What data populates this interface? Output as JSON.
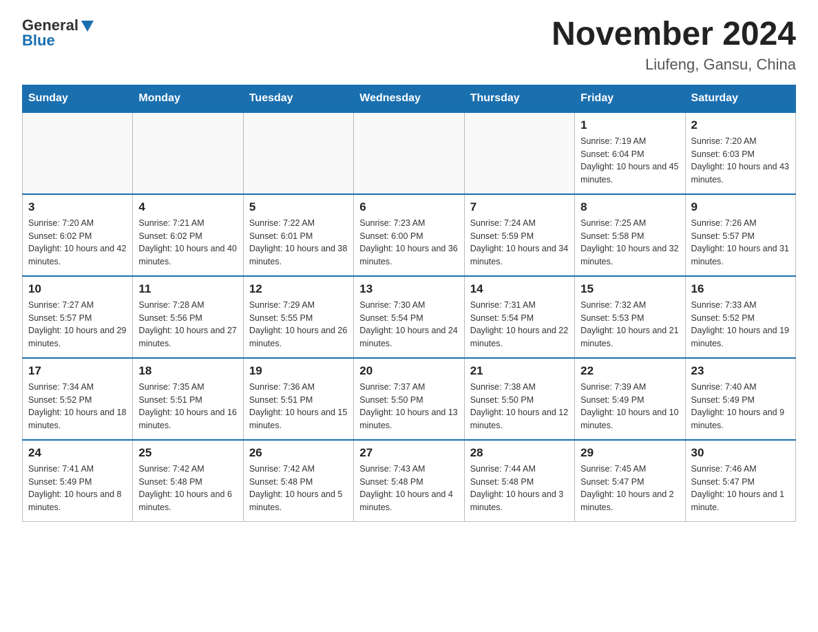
{
  "header": {
    "logo_general": "General",
    "logo_blue": "Blue",
    "month_title": "November 2024",
    "location": "Liufeng, Gansu, China"
  },
  "weekdays": [
    "Sunday",
    "Monday",
    "Tuesday",
    "Wednesday",
    "Thursday",
    "Friday",
    "Saturday"
  ],
  "weeks": [
    [
      {
        "day": "",
        "sunrise": "",
        "sunset": "",
        "daylight": "",
        "empty": true
      },
      {
        "day": "",
        "sunrise": "",
        "sunset": "",
        "daylight": "",
        "empty": true
      },
      {
        "day": "",
        "sunrise": "",
        "sunset": "",
        "daylight": "",
        "empty": true
      },
      {
        "day": "",
        "sunrise": "",
        "sunset": "",
        "daylight": "",
        "empty": true
      },
      {
        "day": "",
        "sunrise": "",
        "sunset": "",
        "daylight": "",
        "empty": true
      },
      {
        "day": "1",
        "sunrise": "Sunrise: 7:19 AM",
        "sunset": "Sunset: 6:04 PM",
        "daylight": "Daylight: 10 hours and 45 minutes.",
        "empty": false
      },
      {
        "day": "2",
        "sunrise": "Sunrise: 7:20 AM",
        "sunset": "Sunset: 6:03 PM",
        "daylight": "Daylight: 10 hours and 43 minutes.",
        "empty": false
      }
    ],
    [
      {
        "day": "3",
        "sunrise": "Sunrise: 7:20 AM",
        "sunset": "Sunset: 6:02 PM",
        "daylight": "Daylight: 10 hours and 42 minutes.",
        "empty": false
      },
      {
        "day": "4",
        "sunrise": "Sunrise: 7:21 AM",
        "sunset": "Sunset: 6:02 PM",
        "daylight": "Daylight: 10 hours and 40 minutes.",
        "empty": false
      },
      {
        "day": "5",
        "sunrise": "Sunrise: 7:22 AM",
        "sunset": "Sunset: 6:01 PM",
        "daylight": "Daylight: 10 hours and 38 minutes.",
        "empty": false
      },
      {
        "day": "6",
        "sunrise": "Sunrise: 7:23 AM",
        "sunset": "Sunset: 6:00 PM",
        "daylight": "Daylight: 10 hours and 36 minutes.",
        "empty": false
      },
      {
        "day": "7",
        "sunrise": "Sunrise: 7:24 AM",
        "sunset": "Sunset: 5:59 PM",
        "daylight": "Daylight: 10 hours and 34 minutes.",
        "empty": false
      },
      {
        "day": "8",
        "sunrise": "Sunrise: 7:25 AM",
        "sunset": "Sunset: 5:58 PM",
        "daylight": "Daylight: 10 hours and 32 minutes.",
        "empty": false
      },
      {
        "day": "9",
        "sunrise": "Sunrise: 7:26 AM",
        "sunset": "Sunset: 5:57 PM",
        "daylight": "Daylight: 10 hours and 31 minutes.",
        "empty": false
      }
    ],
    [
      {
        "day": "10",
        "sunrise": "Sunrise: 7:27 AM",
        "sunset": "Sunset: 5:57 PM",
        "daylight": "Daylight: 10 hours and 29 minutes.",
        "empty": false
      },
      {
        "day": "11",
        "sunrise": "Sunrise: 7:28 AM",
        "sunset": "Sunset: 5:56 PM",
        "daylight": "Daylight: 10 hours and 27 minutes.",
        "empty": false
      },
      {
        "day": "12",
        "sunrise": "Sunrise: 7:29 AM",
        "sunset": "Sunset: 5:55 PM",
        "daylight": "Daylight: 10 hours and 26 minutes.",
        "empty": false
      },
      {
        "day": "13",
        "sunrise": "Sunrise: 7:30 AM",
        "sunset": "Sunset: 5:54 PM",
        "daylight": "Daylight: 10 hours and 24 minutes.",
        "empty": false
      },
      {
        "day": "14",
        "sunrise": "Sunrise: 7:31 AM",
        "sunset": "Sunset: 5:54 PM",
        "daylight": "Daylight: 10 hours and 22 minutes.",
        "empty": false
      },
      {
        "day": "15",
        "sunrise": "Sunrise: 7:32 AM",
        "sunset": "Sunset: 5:53 PM",
        "daylight": "Daylight: 10 hours and 21 minutes.",
        "empty": false
      },
      {
        "day": "16",
        "sunrise": "Sunrise: 7:33 AM",
        "sunset": "Sunset: 5:52 PM",
        "daylight": "Daylight: 10 hours and 19 minutes.",
        "empty": false
      }
    ],
    [
      {
        "day": "17",
        "sunrise": "Sunrise: 7:34 AM",
        "sunset": "Sunset: 5:52 PM",
        "daylight": "Daylight: 10 hours and 18 minutes.",
        "empty": false
      },
      {
        "day": "18",
        "sunrise": "Sunrise: 7:35 AM",
        "sunset": "Sunset: 5:51 PM",
        "daylight": "Daylight: 10 hours and 16 minutes.",
        "empty": false
      },
      {
        "day": "19",
        "sunrise": "Sunrise: 7:36 AM",
        "sunset": "Sunset: 5:51 PM",
        "daylight": "Daylight: 10 hours and 15 minutes.",
        "empty": false
      },
      {
        "day": "20",
        "sunrise": "Sunrise: 7:37 AM",
        "sunset": "Sunset: 5:50 PM",
        "daylight": "Daylight: 10 hours and 13 minutes.",
        "empty": false
      },
      {
        "day": "21",
        "sunrise": "Sunrise: 7:38 AM",
        "sunset": "Sunset: 5:50 PM",
        "daylight": "Daylight: 10 hours and 12 minutes.",
        "empty": false
      },
      {
        "day": "22",
        "sunrise": "Sunrise: 7:39 AM",
        "sunset": "Sunset: 5:49 PM",
        "daylight": "Daylight: 10 hours and 10 minutes.",
        "empty": false
      },
      {
        "day": "23",
        "sunrise": "Sunrise: 7:40 AM",
        "sunset": "Sunset: 5:49 PM",
        "daylight": "Daylight: 10 hours and 9 minutes.",
        "empty": false
      }
    ],
    [
      {
        "day": "24",
        "sunrise": "Sunrise: 7:41 AM",
        "sunset": "Sunset: 5:49 PM",
        "daylight": "Daylight: 10 hours and 8 minutes.",
        "empty": false
      },
      {
        "day": "25",
        "sunrise": "Sunrise: 7:42 AM",
        "sunset": "Sunset: 5:48 PM",
        "daylight": "Daylight: 10 hours and 6 minutes.",
        "empty": false
      },
      {
        "day": "26",
        "sunrise": "Sunrise: 7:42 AM",
        "sunset": "Sunset: 5:48 PM",
        "daylight": "Daylight: 10 hours and 5 minutes.",
        "empty": false
      },
      {
        "day": "27",
        "sunrise": "Sunrise: 7:43 AM",
        "sunset": "Sunset: 5:48 PM",
        "daylight": "Daylight: 10 hours and 4 minutes.",
        "empty": false
      },
      {
        "day": "28",
        "sunrise": "Sunrise: 7:44 AM",
        "sunset": "Sunset: 5:48 PM",
        "daylight": "Daylight: 10 hours and 3 minutes.",
        "empty": false
      },
      {
        "day": "29",
        "sunrise": "Sunrise: 7:45 AM",
        "sunset": "Sunset: 5:47 PM",
        "daylight": "Daylight: 10 hours and 2 minutes.",
        "empty": false
      },
      {
        "day": "30",
        "sunrise": "Sunrise: 7:46 AM",
        "sunset": "Sunset: 5:47 PM",
        "daylight": "Daylight: 10 hours and 1 minute.",
        "empty": false
      }
    ]
  ]
}
